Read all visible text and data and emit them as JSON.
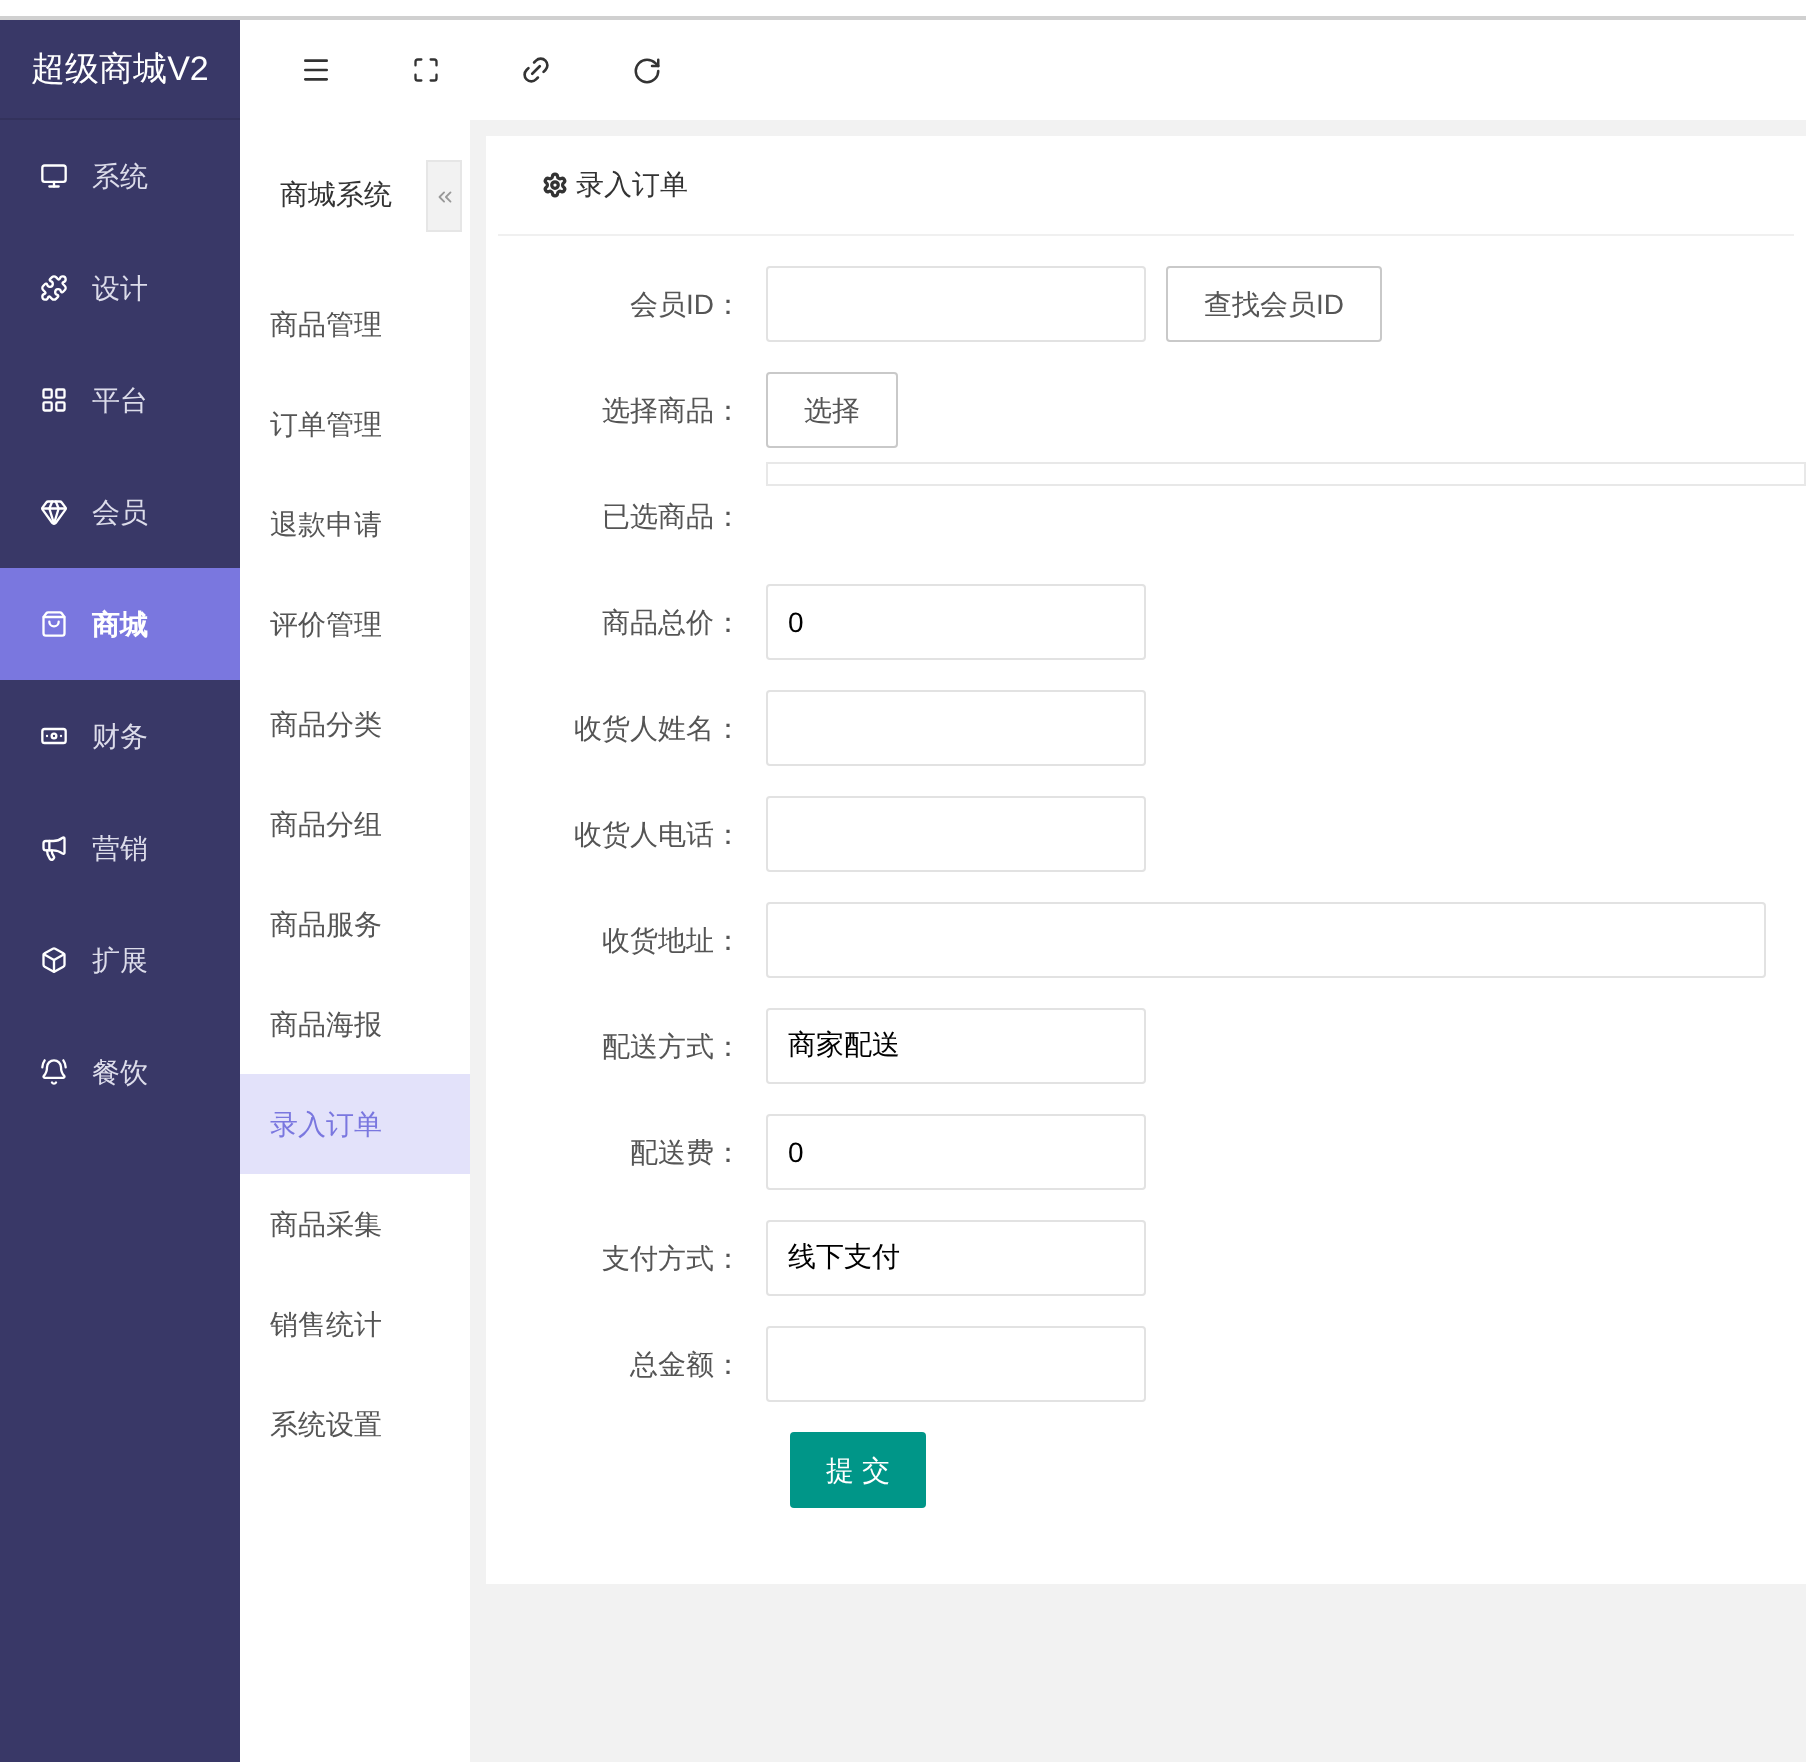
{
  "brand": "超级商城V2",
  "main_menu": [
    {
      "label": "系统",
      "selected": false
    },
    {
      "label": "设计",
      "selected": false
    },
    {
      "label": "平台",
      "selected": false
    },
    {
      "label": "会员",
      "selected": false
    },
    {
      "label": "商城",
      "selected": true
    },
    {
      "label": "财务",
      "selected": false
    },
    {
      "label": "营销",
      "selected": false
    },
    {
      "label": "扩展",
      "selected": false
    },
    {
      "label": "餐饮",
      "selected": false
    }
  ],
  "sub_menu": {
    "title": "商城系统",
    "items": [
      {
        "label": "商品管理",
        "selected": false
      },
      {
        "label": "订单管理",
        "selected": false
      },
      {
        "label": "退款申请",
        "selected": false
      },
      {
        "label": "评价管理",
        "selected": false
      },
      {
        "label": "商品分类",
        "selected": false
      },
      {
        "label": "商品分组",
        "selected": false
      },
      {
        "label": "商品服务",
        "selected": false
      },
      {
        "label": "商品海报",
        "selected": false
      },
      {
        "label": "录入订单",
        "selected": true
      },
      {
        "label": "商品采集",
        "selected": false
      },
      {
        "label": "销售统计",
        "selected": false
      },
      {
        "label": "系统设置",
        "selected": false
      }
    ]
  },
  "card": {
    "title": "录入订单",
    "fields": [
      {
        "kind": "input",
        "label": "会员ID：",
        "button": "查找会员ID"
      },
      {
        "kind": "button",
        "label": "选择商品：",
        "button": "选择"
      },
      {
        "kind": "list",
        "label": "已选商品："
      },
      {
        "kind": "input",
        "label": "商品总价：",
        "value": "0"
      },
      {
        "kind": "input",
        "label": "收货人姓名："
      },
      {
        "kind": "input",
        "label": "收货人电话："
      },
      {
        "kind": "wide",
        "label": "收货地址："
      },
      {
        "kind": "input",
        "label": "配送方式：",
        "value": "商家配送"
      },
      {
        "kind": "input",
        "label": "配送费：",
        "value": "0"
      },
      {
        "kind": "input",
        "label": "支付方式：",
        "value": "线下支付"
      },
      {
        "kind": "input",
        "label": "总金额："
      }
    ],
    "submit": "提 交"
  }
}
